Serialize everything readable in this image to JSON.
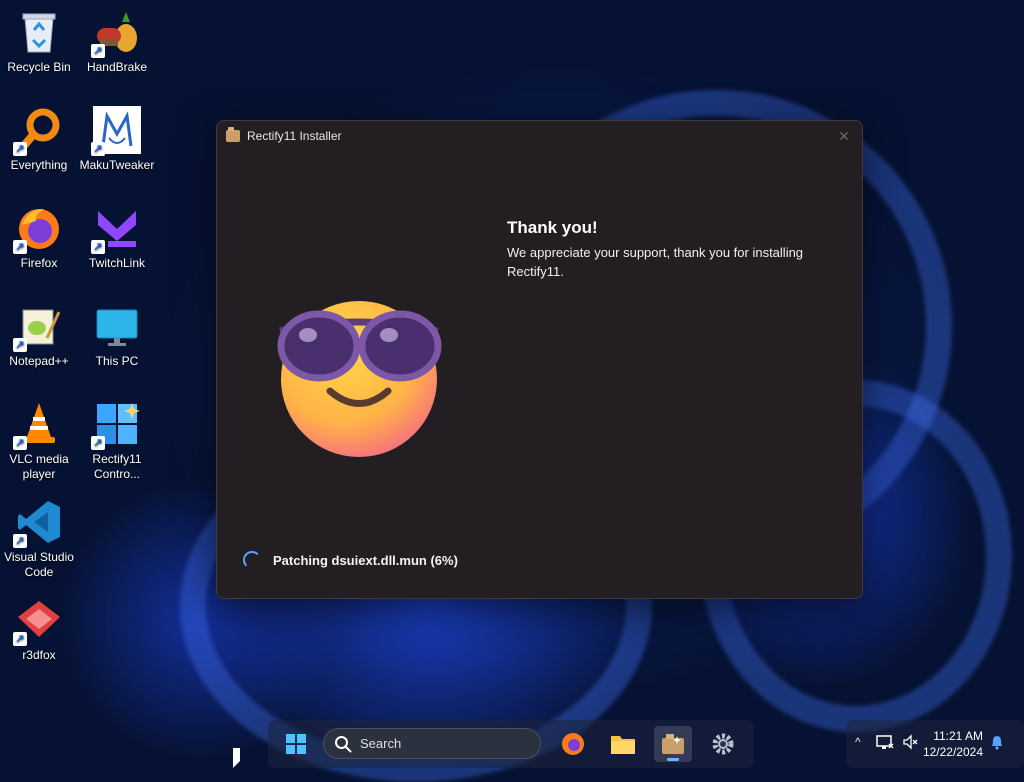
{
  "desktop": {
    "icons": [
      {
        "label": "Recycle Bin",
        "icon": "recycle-bin-icon"
      },
      {
        "label": "HandBrake",
        "icon": "handbrake-icon"
      },
      {
        "label": "Everything",
        "icon": "everything-icon"
      },
      {
        "label": "MakuTweaker",
        "icon": "makutweaker-icon"
      },
      {
        "label": "Firefox",
        "icon": "firefox-icon"
      },
      {
        "label": "TwitchLink",
        "icon": "twitchlink-icon"
      },
      {
        "label": "Notepad++",
        "icon": "notepadpp-icon"
      },
      {
        "label": "This PC",
        "icon": "this-pc-icon"
      },
      {
        "label": "VLC media player",
        "icon": "vlc-icon"
      },
      {
        "label": "Rectify11 Contro...",
        "icon": "rectify11-control-icon"
      },
      {
        "label": "Visual Studio Code",
        "icon": "vscode-icon"
      },
      {
        "label": "r3dfox",
        "icon": "r3dfox-icon"
      }
    ]
  },
  "window": {
    "title": "Rectify11 Installer",
    "close_glyph": "✕",
    "heading": "Thank you!",
    "message": "We appreciate your support, thank you for installing Rectify11.",
    "status": "Patching dsuiext.dll.mun (6%)",
    "progress_percent": 6,
    "accent": "#5aa0ff"
  },
  "taskbar": {
    "search_placeholder": "Search",
    "apps": [
      "start-icon",
      "firefox-icon",
      "file-explorer-icon",
      "rectify11-installer-icon",
      "settings-icon"
    ],
    "active_app": "rectify11-installer-icon"
  },
  "tray": {
    "time": "11:21 AM",
    "date": "12/22/2024",
    "chevron": "^"
  }
}
